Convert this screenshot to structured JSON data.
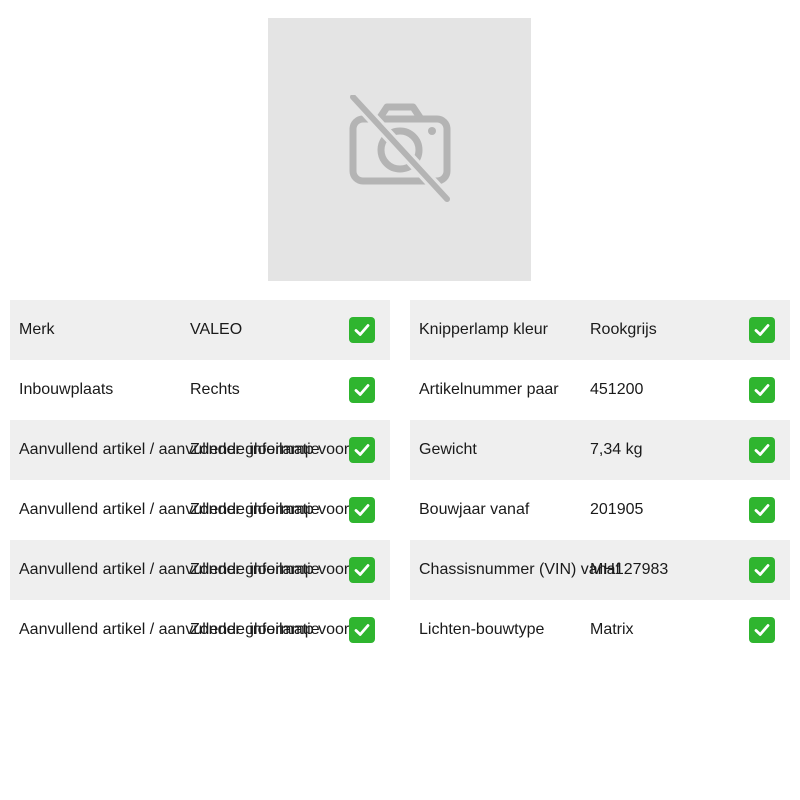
{
  "image": {
    "icon": "no-photo-camera-icon"
  },
  "left_table": {
    "rows": [
      {
        "label": "Merk",
        "value": "VALEO",
        "status_icon": "check-mark-icon"
      },
      {
        "label": "Inbouwplaats",
        "value": "Rechts",
        "status_icon": "check-mark-icon"
      },
      {
        "label": "Aanvullend artikel / aanvullende informatie",
        "value": "Zonder gloeilamp voor im",
        "status_icon": "check-mark-icon"
      },
      {
        "label": "Aanvullend artikel / aanvullende informatie",
        "value": "Zonder gloeilamp voor ro",
        "status_icon": "check-mark-icon"
      },
      {
        "label": "Aanvullend artikel / aanvullende informatie",
        "value": "Zonder gloeilamp voor ag",
        "status_icon": "check-mark-icon"
      },
      {
        "label": "Aanvullend artikel / aanvullende informatie",
        "value": "Zonder gloeilamp voor nip",
        "status_icon": "check-mark-icon"
      }
    ]
  },
  "right_table": {
    "rows": [
      {
        "label": "Knipperlamp kleur",
        "value": "Rookgrijs",
        "status_icon": "check-mark-icon"
      },
      {
        "label": "Artikelnummer paar",
        "value": "451200",
        "status_icon": "check-mark-icon"
      },
      {
        "label": "Gewicht",
        "value": "7,34 kg",
        "status_icon": "check-mark-icon"
      },
      {
        "label": "Bouwjaar vanaf",
        "value": "201905",
        "status_icon": "check-mark-icon"
      },
      {
        "label": "Chassisnummer (VIN) vanaf",
        "value": "MH127983",
        "status_icon": "check-mark-icon"
      },
      {
        "label": "Lichten-bouwtype",
        "value": "Matrix",
        "status_icon": "check-mark-icon"
      }
    ]
  },
  "colors": {
    "row_shade": "#efefef",
    "placeholder_bg": "#e4e4e4",
    "placeholder_icon": "#b4b4b4",
    "check_bg": "#2fb52f"
  }
}
